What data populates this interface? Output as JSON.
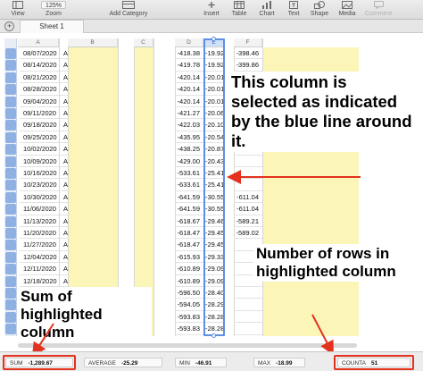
{
  "toolbar": {
    "zoom_value": "125%",
    "view_label": "View",
    "zoom_label": "Zoom",
    "add_category_label": "Add Category",
    "insert_label": "Insert",
    "table_label": "Table",
    "chart_label": "Chart",
    "text_label": "Text",
    "shape_label": "Shape",
    "media_label": "Media",
    "comment_label": "Comment"
  },
  "tabs": {
    "add_label": "+",
    "sheet1_label": "Sheet 1"
  },
  "columns": {
    "a": "A",
    "b": "B",
    "c": "C",
    "d": "D",
    "e": "E",
    "f": "F"
  },
  "rows": [
    {
      "date": "08/07/2020",
      "a": "A",
      "d": "-418.38",
      "e": "-19.92",
      "f": "-398.46"
    },
    {
      "date": "08/14/2020",
      "a": "A",
      "d": "-419.78",
      "e": "-19.92",
      "f": "-399.86"
    },
    {
      "date": "08/21/2020",
      "a": "A",
      "d": "-420.14",
      "e": "-20.01",
      "f": ""
    },
    {
      "date": "08/28/2020",
      "a": "A",
      "d": "-420.14",
      "e": "-20.01",
      "f": ""
    },
    {
      "date": "09/04/2020",
      "a": "A",
      "d": "-420.14",
      "e": "-20.01",
      "f": ""
    },
    {
      "date": "09/11/2020",
      "a": "A",
      "d": "-421.27",
      "e": "-20.06",
      "f": "-401.2"
    },
    {
      "date": "09/18/2020",
      "a": "A",
      "d": "-422.03",
      "e": "-20.10",
      "f": "-401.9"
    },
    {
      "date": "09/25/2020",
      "a": "A",
      "d": "-435.95",
      "e": "-20.54",
      "f": ""
    },
    {
      "date": "10/02/2020",
      "a": "A",
      "d": "-438.25",
      "e": "-20.87",
      "f": ""
    },
    {
      "date": "10/09/2020",
      "a": "A",
      "d": "-429.00",
      "e": "-20.43",
      "f": ""
    },
    {
      "date": "10/16/2020",
      "a": "A",
      "d": "-533.61",
      "e": "-25.41",
      "f": ""
    },
    {
      "date": "10/23/2020",
      "a": "A",
      "d": "-633.61",
      "e": "-25.41",
      "f": ""
    },
    {
      "date": "10/30/2020",
      "a": "A",
      "d": "-641.59",
      "e": "-30.55",
      "f": "-611.04"
    },
    {
      "date": "11/06/2020",
      "a": "A",
      "d": "-641.59",
      "e": "-30.55",
      "f": "-611.04"
    },
    {
      "date": "11/13/2020",
      "a": "A",
      "d": "-618.67",
      "e": "-29.46",
      "f": "-589.21"
    },
    {
      "date": "11/20/2020",
      "a": "A",
      "d": "-618.47",
      "e": "-29.45",
      "f": "-589.02"
    },
    {
      "date": "11/27/2020",
      "a": "A",
      "d": "-618.47",
      "e": "-29.45",
      "f": ""
    },
    {
      "date": "12/04/2020",
      "a": "A",
      "d": "-615.93",
      "e": "-29.33",
      "f": ""
    },
    {
      "date": "12/11/2020",
      "a": "A",
      "d": "-610.89",
      "e": "-29.09",
      "f": ""
    },
    {
      "date": "12/18/2020",
      "a": "A",
      "d": "-610.89",
      "e": "-29.09",
      "f": ""
    },
    {
      "date": "12/25/2020",
      "a": "A",
      "d": "-596.50",
      "e": "-28.40",
      "f": ""
    },
    {
      "date": "",
      "a": "A",
      "d": "-594.05",
      "e": "-28.29",
      "f": ""
    },
    {
      "date": "",
      "a": "A",
      "d": "-593.83",
      "e": "-28.28",
      "f": ""
    },
    {
      "date": "",
      "a": "A",
      "d": "-593.83",
      "e": "-28.28",
      "f": ""
    }
  ],
  "annotations": {
    "selected_column": "This column is selected as indicated by the blue line around it.",
    "row_count": "Number of rows in highlighted column",
    "sum": "Sum of highlighted column"
  },
  "status": {
    "sum_label": "SUM",
    "sum_value": "-1,289.67",
    "average_label": "AVERAGE",
    "average_value": "-25.29",
    "min_label": "MIN",
    "min_value": "-46.91",
    "max_label": "MAX",
    "max_value": "-18.99",
    "counta_label": "COUNTA",
    "counta_value": "51"
  },
  "colors": {
    "selection": "#5b8fe6",
    "highlight_red": "#e3321d",
    "yellow_fill": "#fbf6b8"
  }
}
